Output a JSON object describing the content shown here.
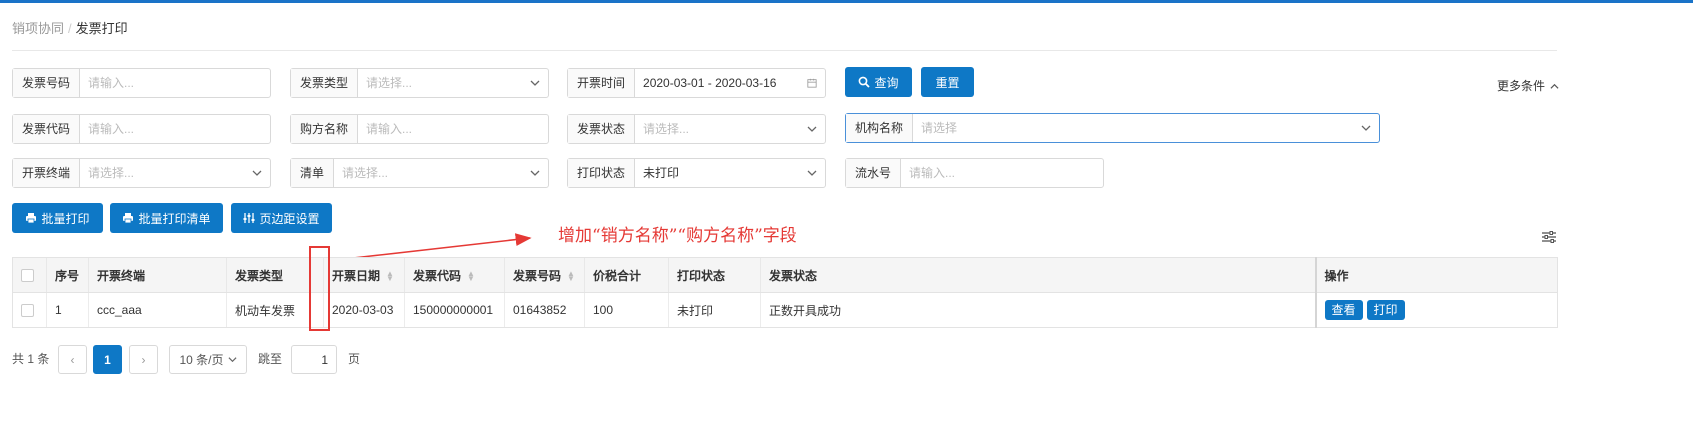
{
  "breadcrumb": {
    "parent": "销项协同",
    "separator": "/",
    "current": "发票打印"
  },
  "filters": {
    "invoice_no": {
      "label": "发票号码",
      "placeholder": "请输入..."
    },
    "invoice_type": {
      "label": "发票类型",
      "placeholder": "请选择..."
    },
    "issue_time": {
      "label": "开票时间",
      "value": "2020-03-01 - 2020-03-16"
    },
    "invoice_code": {
      "label": "发票代码",
      "placeholder": "请输入..."
    },
    "buyer_name": {
      "label": "购方名称",
      "placeholder": "请输入..."
    },
    "invoice_status": {
      "label": "发票状态",
      "placeholder": "请选择..."
    },
    "org_name": {
      "label": "机构名称",
      "placeholder": "请选择"
    },
    "terminal": {
      "label": "开票终端",
      "placeholder": "请选择..."
    },
    "list": {
      "label": "清单",
      "placeholder": "请选择..."
    },
    "print_status": {
      "label": "打印状态",
      "value": "未打印"
    },
    "serial_no": {
      "label": "流水号",
      "placeholder": "请输入..."
    }
  },
  "buttons": {
    "query": "查询",
    "reset": "重置",
    "more": "更多条件",
    "batch_print": "批量打印",
    "batch_print_list": "批量打印清单",
    "page_margin": "页边距设置"
  },
  "annotation": "增加“销方名称”“购方名称”字段",
  "table": {
    "headers": [
      "序号",
      "开票终端",
      "发票类型",
      "开票日期",
      "发票代码",
      "发票号码",
      "价税合计",
      "打印状态",
      "发票状态",
      "操作"
    ],
    "rows": [
      {
        "index": "1",
        "terminal": "ccc_aaa",
        "type": "机动车发票",
        "date": "2020-03-03",
        "code": "150000000001",
        "number": "01643852",
        "total": "100",
        "print_status": "未打印",
        "invoice_status": "正数开具成功",
        "actions": [
          "查看",
          "打印"
        ]
      }
    ]
  },
  "pagination": {
    "total_text": "共 1 条",
    "prev": "‹",
    "current_page": "1",
    "next": "›",
    "page_size": "10 条/页",
    "jump_label": "跳至",
    "jump_value": "1",
    "page_suffix": "页"
  },
  "colors": {
    "primary": "#0e78c6",
    "annotation": "#e53935",
    "topbar": "#1a73c8"
  },
  "icons": {
    "search": "search-icon",
    "printer": "printer-icon",
    "margin": "margin-settings-icon",
    "calendar": "calendar-icon",
    "chevron": "chevron-down-icon",
    "column_settings": "column-settings-icon"
  }
}
